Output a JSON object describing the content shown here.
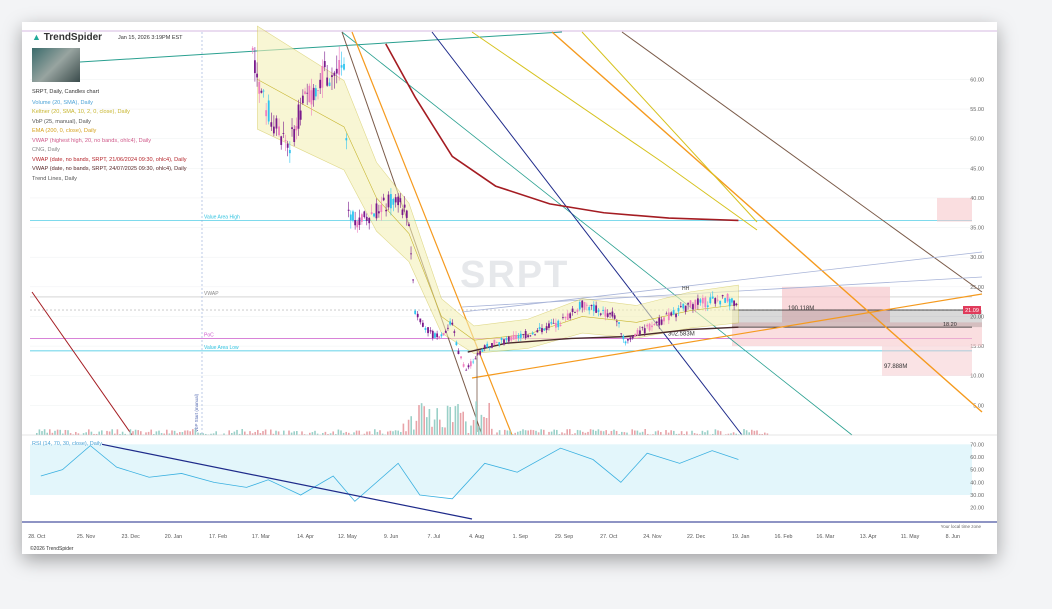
{
  "header": {
    "brand": "TrendSpider",
    "timestamp": "Jan 15, 2026 3:19PM EST",
    "symbol_line": "SRPT, Daily, Candles chart",
    "watermark": "SRPT"
  },
  "legend": [
    {
      "text": "Volume (20, SMA), Daily",
      "color": "#4da3d6"
    },
    {
      "text": "Keltner (20, SMA, 10, 2, 0, close), Daily",
      "color": "#c7b52e"
    },
    {
      "text": "VbP (25, manual), Daily",
      "color": "#555555"
    },
    {
      "text": "EMA (200, 0, close), Daily",
      "color": "#d6a21e"
    },
    {
      "text": "VWAP (highest high, 20, no bands, ohlc4), Daily",
      "color": "#d05a8a"
    },
    {
      "text": "CNG, Daily",
      "color": "#888888"
    },
    {
      "text": "VWAP (date, no bands, SRPT, 21/06/2024 09:30, ohlc4), Daily",
      "color": "#b5252b"
    },
    {
      "text": "VWAP (date, no bands, SRPT, 24/07/2025 09:30, ohlc4), Daily",
      "color": "#5a2a2a"
    },
    {
      "text": "Trend Lines, Daily",
      "color": "#555555"
    }
  ],
  "annotations": {
    "value_area_high": "Value Area High",
    "value_area_low": "Value Area Low",
    "vwap": "VWAP",
    "poc": "PoC",
    "vbp_start": "VbP Start (manual)",
    "vol_190": "190.118M",
    "vol_302": "302.583M",
    "vol_97": "97.888M",
    "price_1820": "18.20",
    "hh": "HH",
    "last_price": "21.09"
  },
  "footer": {
    "copyright": "©2026 TrendSpider",
    "timezone": "Your local time zone"
  },
  "colors": {
    "up": "#2ec4f1",
    "down": "#7a1a8c",
    "pink": "#f07fc0",
    "ema": "#d6c21e",
    "vwap_red": "#a41c22",
    "vwap_brown": "#4a2a2a",
    "orange": "#f59a1e",
    "navy": "#1e2a8a",
    "teal": "#2aa090",
    "cyan_line": "#31c3e0",
    "magenta_line": "#cc5acc"
  },
  "chart_data": [
    {
      "type": "candlestick",
      "title": "SRPT, Daily, Candles chart",
      "x_ticks": [
        "28. Oct",
        "25. Nov",
        "23. Dec",
        "20. Jan",
        "17. Feb",
        "17. Mar",
        "14. Apr",
        "12. May",
        "9. Jun",
        "7. Jul",
        "4. Aug",
        "1. Sep",
        "29. Sep",
        "27. Oct",
        "24. Nov",
        "22. Dec",
        "19. Jan",
        "16. Feb",
        "16. Mar",
        "13. Apr",
        "11. May",
        "8. Jun"
      ],
      "y_ticks": [
        5,
        10,
        15,
        20,
        25,
        30,
        35,
        40,
        45,
        50,
        55,
        60
      ],
      "y_tick_labels": [
        "5.00",
        "10.00",
        "15.00",
        "20.00",
        "25.00",
        "30.00",
        "35.00",
        "40.00",
        "45.00",
        "50.00",
        "55.00",
        "60.00"
      ],
      "ylim": [
        0,
        68
      ],
      "levels": {
        "value_area_high": 36.2,
        "vwap": 23.3,
        "poc": 16.3,
        "value_area_low": 14.2,
        "last": 21.09,
        "ma18": 18.2
      },
      "price_path": [
        {
          "x": "2025-03-07",
          "y": 65
        },
        {
          "x": "2025-03-14",
          "y": 56
        },
        {
          "x": "2025-03-24",
          "y": 51
        },
        {
          "x": "2025-03-31",
          "y": 49
        },
        {
          "x": "2025-04-07",
          "y": 55
        },
        {
          "x": "2025-04-14",
          "y": 58
        },
        {
          "x": "2025-04-21",
          "y": 61
        },
        {
          "x": "2025-05-05",
          "y": 61
        },
        {
          "x": "2025-05-08",
          "y": 38
        },
        {
          "x": "2025-05-15",
          "y": 36
        },
        {
          "x": "2025-05-26",
          "y": 38
        },
        {
          "x": "2025-06-09",
          "y": 40
        },
        {
          "x": "2025-06-16",
          "y": 36
        },
        {
          "x": "2025-06-20",
          "y": 21
        },
        {
          "x": "2025-06-30",
          "y": 17
        },
        {
          "x": "2025-07-07",
          "y": 17
        },
        {
          "x": "2025-07-14",
          "y": 19
        },
        {
          "x": "2025-07-18",
          "y": 14
        },
        {
          "x": "2025-07-23",
          "y": 11
        },
        {
          "x": "2025-08-04",
          "y": 15
        },
        {
          "x": "2025-09-01",
          "y": 17
        },
        {
          "x": "2025-09-22",
          "y": 19
        },
        {
          "x": "2025-10-06",
          "y": 22
        },
        {
          "x": "2025-10-27",
          "y": 20
        },
        {
          "x": "2025-11-03",
          "y": 16
        },
        {
          "x": "2025-11-17",
          "y": 18
        },
        {
          "x": "2025-12-01",
          "y": 20
        },
        {
          "x": "2025-12-15",
          "y": 22
        },
        {
          "x": "2026-01-08",
          "y": 23
        },
        {
          "x": "2026-01-15",
          "y": 21.09
        }
      ],
      "ema200": [
        {
          "x": "2025-06-01",
          "y": 66
        },
        {
          "x": "2025-06-20",
          "y": 57
        },
        {
          "x": "2025-07-14",
          "y": 47
        },
        {
          "x": "2025-08-11",
          "y": 42
        },
        {
          "x": "2025-09-15",
          "y": 39
        },
        {
          "x": "2025-10-20",
          "y": 37.5
        },
        {
          "x": "2025-12-01",
          "y": 36.6
        },
        {
          "x": "2026-01-15",
          "y": 36.2
        }
      ],
      "vwap_2025": [
        {
          "x": "2025-07-24",
          "y": 14
        },
        {
          "x": "2025-08-18",
          "y": 15.5
        },
        {
          "x": "2025-09-29",
          "y": 16.3
        },
        {
          "x": "2025-11-03",
          "y": 16.6
        },
        {
          "x": "2025-12-15",
          "y": 17.8
        },
        {
          "x": "2026-01-15",
          "y": 18.2
        }
      ],
      "keltner_mid": [
        {
          "x": "2025-03-10",
          "y": 60
        },
        {
          "x": "2025-04-07",
          "y": 56
        },
        {
          "x": "2025-05-05",
          "y": 52
        },
        {
          "x": "2025-05-26",
          "y": 40
        },
        {
          "x": "2025-06-16",
          "y": 34
        },
        {
          "x": "2025-07-07",
          "y": 20
        },
        {
          "x": "2025-07-28",
          "y": 16
        },
        {
          "x": "2025-09-01",
          "y": 17
        },
        {
          "x": "2025-10-06",
          "y": 20
        },
        {
          "x": "2025-11-10",
          "y": 19
        },
        {
          "x": "2025-12-15",
          "y": 21
        },
        {
          "x": "2026-01-15",
          "y": 22
        }
      ],
      "volume_ticks": []
    },
    {
      "type": "line",
      "title": "RSI (14, 70, 30, close), Daily",
      "y_ticks": [
        20,
        30,
        40,
        50,
        60,
        70
      ],
      "y_tick_labels": [
        "20.00",
        "30.00",
        "40.00",
        "50.00",
        "60.00",
        "70.00"
      ],
      "ylim": [
        15,
        75
      ],
      "bands": [
        30,
        70
      ],
      "values": [
        {
          "x": "2024-10-21",
          "y": 45
        },
        {
          "x": "2024-11-04",
          "y": 50
        },
        {
          "x": "2024-11-22",
          "y": 69
        },
        {
          "x": "2024-12-09",
          "y": 52
        },
        {
          "x": "2024-12-30",
          "y": 44
        },
        {
          "x": "2025-01-20",
          "y": 47
        },
        {
          "x": "2025-02-10",
          "y": 40
        },
        {
          "x": "2025-03-03",
          "y": 36
        },
        {
          "x": "2025-03-17",
          "y": 42
        },
        {
          "x": "2025-04-07",
          "y": 30
        },
        {
          "x": "2025-04-28",
          "y": 45
        },
        {
          "x": "2025-05-12",
          "y": 25
        },
        {
          "x": "2025-06-09",
          "y": 55
        },
        {
          "x": "2025-06-23",
          "y": 30
        },
        {
          "x": "2025-07-14",
          "y": 27
        },
        {
          "x": "2025-08-04",
          "y": 55
        },
        {
          "x": "2025-08-25",
          "y": 48
        },
        {
          "x": "2025-09-22",
          "y": 67
        },
        {
          "x": "2025-10-13",
          "y": 58
        },
        {
          "x": "2025-10-31",
          "y": 40
        },
        {
          "x": "2025-11-17",
          "y": 63
        },
        {
          "x": "2025-12-08",
          "y": 55
        },
        {
          "x": "2025-12-29",
          "y": 65
        },
        {
          "x": "2026-01-15",
          "y": 58
        }
      ]
    }
  ]
}
